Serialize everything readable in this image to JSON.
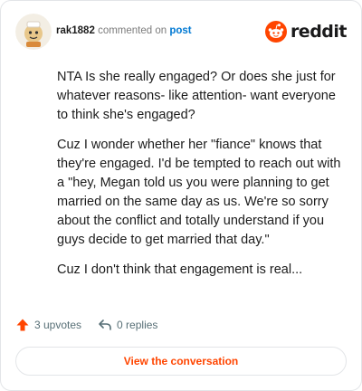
{
  "header": {
    "username": "rak1882",
    "action_text": "commented on",
    "post_link": "post",
    "brand": "reddit"
  },
  "comment": {
    "paragraphs": [
      "NTA Is she really engaged? Or does she just for whatever reasons- like attention- want everyone to think she's engaged?",
      "Cuz I wonder whether her \"fiance\" knows that they're engaged. I'd be tempted to reach out with a \"hey, Megan told us you were planning to get married on the same day as us. We're so sorry about the conflict and totally understand if you guys decide to get married that day.\"",
      "Cuz I don't think that engagement is real..."
    ]
  },
  "stats": {
    "upvotes": "3 upvotes",
    "replies": "0 replies"
  },
  "footer": {
    "view_label": "View the conversation"
  },
  "colors": {
    "accent": "#ff4500",
    "link": "#0079d3",
    "muted": "#576f76",
    "border": "#e3e5e8"
  },
  "icons": {
    "upvote": "upvote-arrow-icon",
    "reply": "reply-arrow-icon",
    "brand": "reddit-snoo-icon"
  }
}
